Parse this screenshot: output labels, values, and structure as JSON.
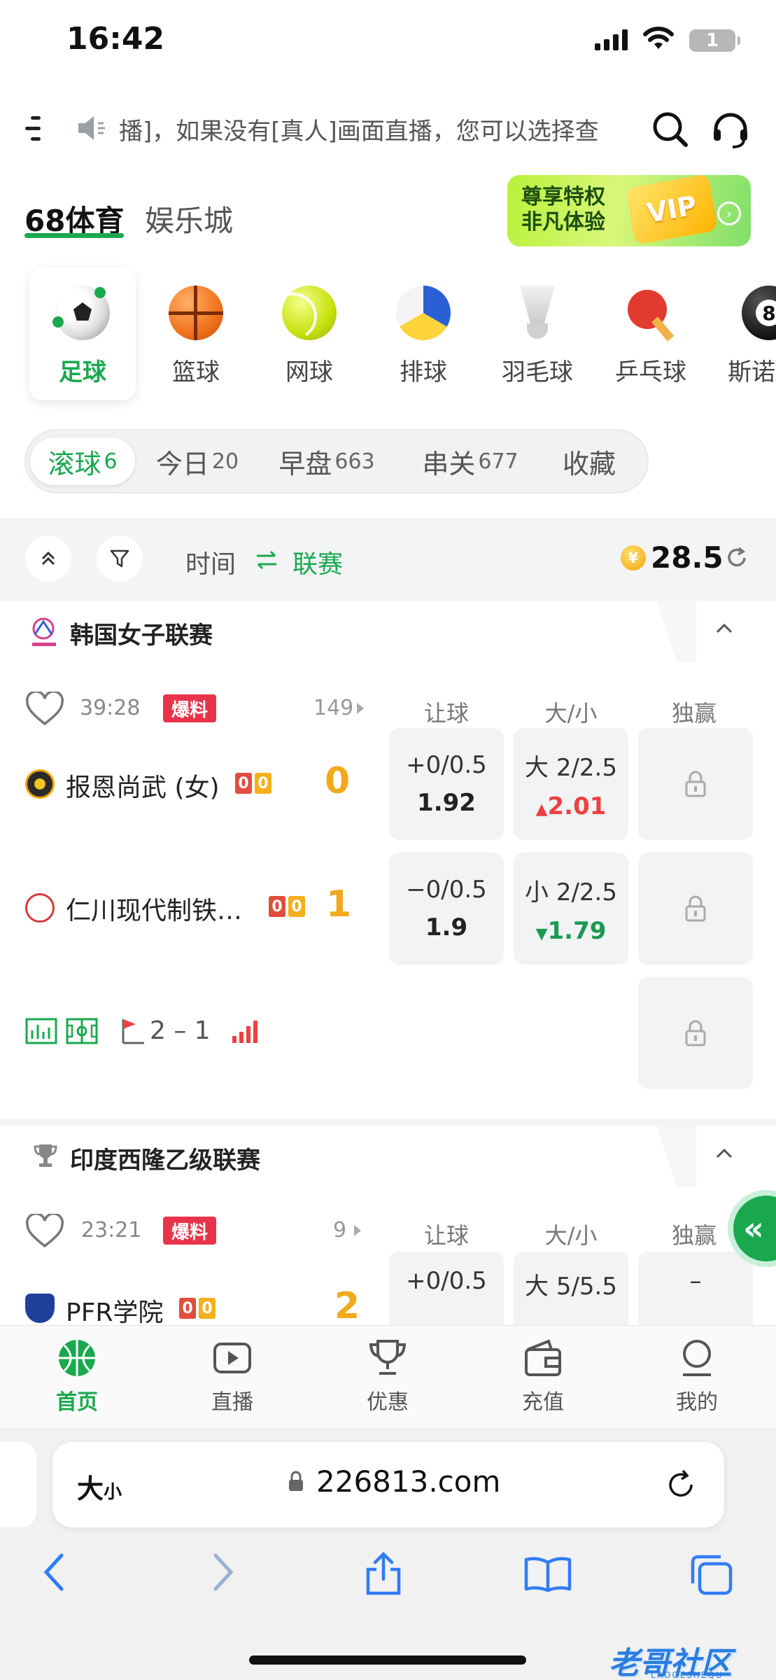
{
  "status": {
    "time": "16:42",
    "battery": "1"
  },
  "header": {
    "marquee": "播]，如果没有[真人]画面直播，您可以选择查",
    "brand": "68体育",
    "casino": "娱乐城",
    "vip_line1": "尊享特权",
    "vip_line2": "非凡体验",
    "vip_tag": "VIP"
  },
  "sports": [
    "足球",
    "篮球",
    "网球",
    "排球",
    "羽毛球",
    "乒乓球",
    "斯诺"
  ],
  "tabs": [
    {
      "label": "滚球",
      "count": "6"
    },
    {
      "label": "今日",
      "count": "20"
    },
    {
      "label": "早盘",
      "count": "663"
    },
    {
      "label": "串关",
      "count": "677"
    },
    {
      "label": "收藏",
      "count": ""
    }
  ],
  "toolbar": {
    "time_label": "时间",
    "league_label": "联赛",
    "balance": "28.5",
    "coin_symbol": "¥"
  },
  "columns": {
    "handicap": "让球",
    "over_under": "大/小",
    "moneyline": "独赢"
  },
  "leagues": [
    {
      "name": "韩国女子联赛",
      "match": {
        "time": "39:28",
        "tip": "爆料",
        "more": "149",
        "home": {
          "name": "报恩尚武 (女)",
          "red": "0",
          "yellow": "0",
          "score": "0"
        },
        "away": {
          "name": "仁川现代制铁…",
          "red": "0",
          "yellow": "0",
          "score": "1"
        },
        "handicap": [
          {
            "line": "+0/0.5",
            "price": "1.92"
          },
          {
            "line": "−0/0.5",
            "price": "1.9"
          }
        ],
        "over_under": [
          {
            "line": "大 2/2.5",
            "price": "2.01",
            "trend": "up"
          },
          {
            "line": "小 2/2.5",
            "price": "1.79",
            "trend": "down"
          }
        ],
        "corners": "2 – 1"
      }
    },
    {
      "name": "印度西隆乙级联赛",
      "match": {
        "time": "23:21",
        "tip": "爆料",
        "more": "9",
        "home": {
          "name": "PFR学院",
          "red": "0",
          "yellow": "0",
          "score": "2"
        },
        "handicap": [
          {
            "line": "+0/0.5"
          }
        ],
        "over_under": [
          {
            "line": "大 5/5.5"
          }
        ],
        "moneyline_text": "–"
      }
    }
  ],
  "bottom_nav": [
    "首页",
    "直播",
    "优惠",
    "充值",
    "我的"
  ],
  "browser": {
    "aa": "大",
    "aa_small": "小",
    "url": "226813.com"
  },
  "watermark": {
    "text": "老哥社区",
    "sub": "LAOGESHEQU"
  },
  "colors": {
    "accent": "#1aa84f",
    "score": "#f2a91b",
    "tip": "#e8334a"
  }
}
